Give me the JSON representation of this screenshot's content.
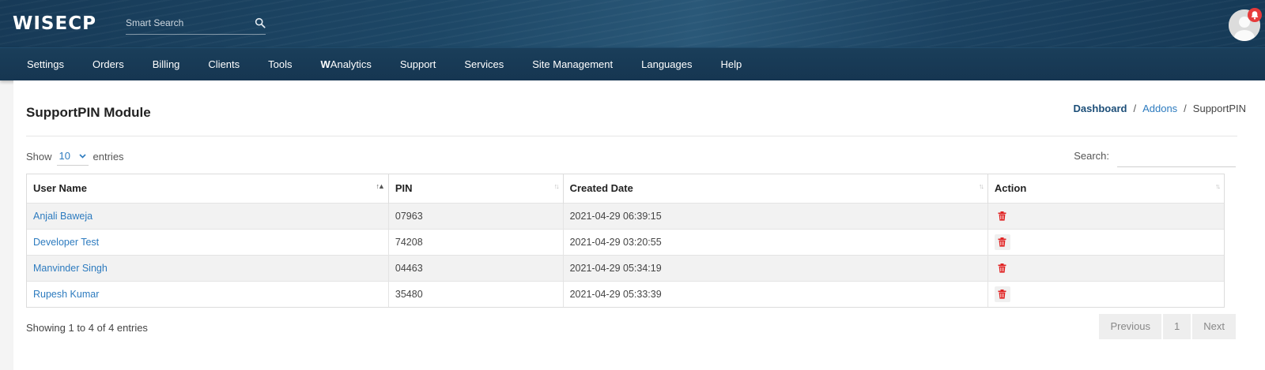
{
  "header": {
    "logo_text": "WISECP",
    "search": {
      "placeholder": "Smart Search",
      "value": ""
    },
    "colors": {
      "nav_bg": "#163651",
      "accent": "#2d7bbf",
      "danger": "#e63a3a"
    }
  },
  "nav": {
    "items": [
      {
        "label": "Settings"
      },
      {
        "label": "Orders"
      },
      {
        "label": "Billing"
      },
      {
        "label": "Clients"
      },
      {
        "label": "Tools"
      },
      {
        "prefix": "W",
        "label": "Analytics"
      },
      {
        "label": "Support"
      },
      {
        "label": "Services"
      },
      {
        "label": "Site Management"
      },
      {
        "label": "Languages"
      },
      {
        "label": "Help"
      }
    ]
  },
  "page": {
    "title": "SupportPIN Module",
    "breadcrumb": {
      "dashboard": "Dashboard",
      "addons": "Addons",
      "current": "SupportPIN",
      "separator": "/"
    }
  },
  "table_controls": {
    "show_label": "Show",
    "entries_label": "entries",
    "length_value": "10",
    "search_label": "Search:",
    "search_value": ""
  },
  "table": {
    "columns": [
      "User Name",
      "PIN",
      "Created Date",
      "Action"
    ],
    "rows": [
      {
        "user": "Anjali Baweja",
        "pin": "07963",
        "created": "2021-04-29 06:39:15"
      },
      {
        "user": "Developer Test",
        "pin": "74208",
        "created": "2021-04-29 03:20:55"
      },
      {
        "user": "Manvinder Singh",
        "pin": "04463",
        "created": "2021-04-29 05:34:19"
      },
      {
        "user": "Rupesh Kumar",
        "pin": "35480",
        "created": "2021-04-29 05:33:39"
      }
    ]
  },
  "footer": {
    "info": "Showing 1 to 4 of 4 entries",
    "pagination": {
      "previous": "Previous",
      "page": "1",
      "next": "Next"
    }
  }
}
